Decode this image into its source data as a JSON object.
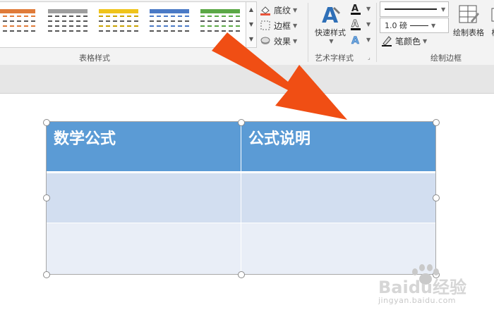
{
  "ribbon": {
    "groups": {
      "table_styles": "表格样式",
      "wordart_styles": "艺术字样式",
      "draw_borders": "绘制边框"
    },
    "shading": "底纹",
    "borders": "边框",
    "effects": "效果",
    "quick_styles": "快速样式",
    "pen_weight": "1.0 磅",
    "pen_color": "笔颜色",
    "draw_table": "绘制表格",
    "eraser_partial": "橡"
  },
  "gallery": {
    "swatch_colors": [
      "#e07b39",
      "#9e9e9e",
      "#f0c419",
      "#4a7ac6",
      "#5ba846"
    ]
  },
  "table": {
    "headers": [
      "数学公式",
      "公式说明"
    ],
    "header_color": "#5b9bd5",
    "band_colors": [
      "#d2def0",
      "#e9eef7"
    ],
    "rows": [
      [
        "",
        ""
      ],
      [
        "",
        ""
      ]
    ]
  },
  "annotation": {
    "arrow_color": "#f04e14"
  },
  "watermark": {
    "brand": "Baidu经验",
    "url": "jingyan.baidu.com"
  }
}
